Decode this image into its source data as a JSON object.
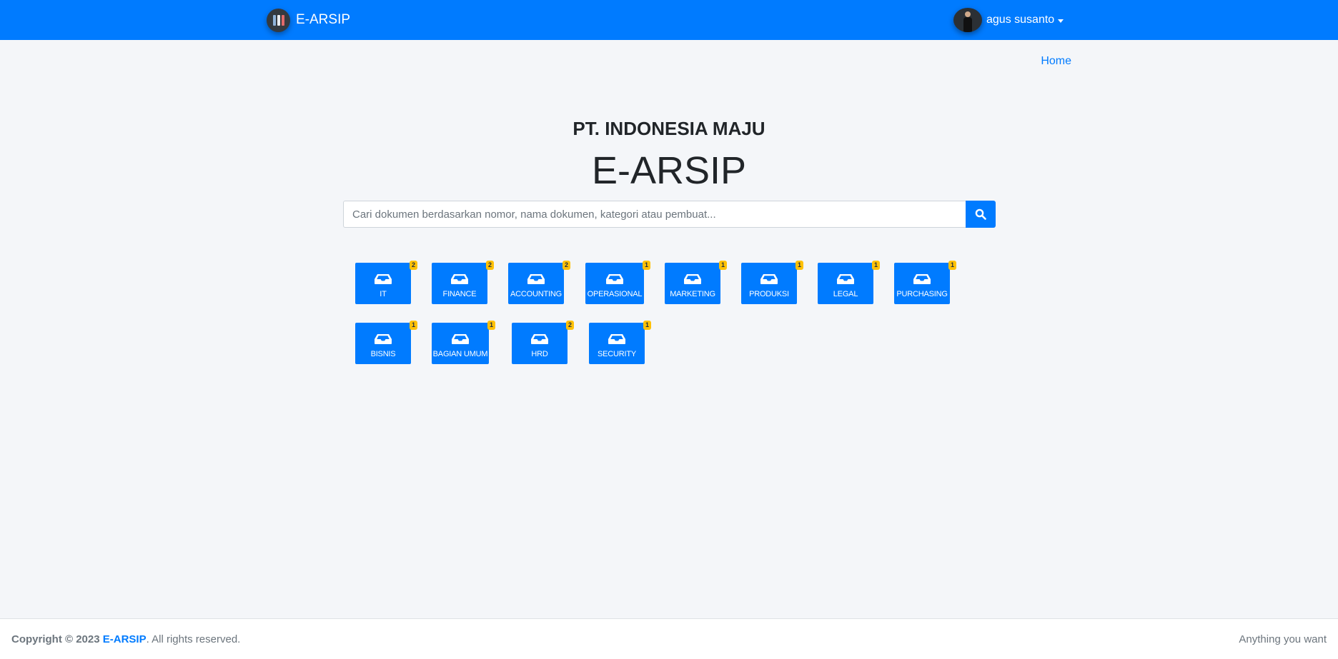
{
  "navbar": {
    "brand": "E-ARSIP",
    "user_name": "agus susanto"
  },
  "breadcrumb": {
    "home": "Home"
  },
  "hero": {
    "company": "PT. INDONESIA MAJU",
    "title": "E-ARSIP"
  },
  "search": {
    "placeholder": "Cari dokumen berdasarkan nomor, nama dokumen, kategori atau pembuat...",
    "value": ""
  },
  "categories": [
    {
      "label": "IT",
      "count": "2"
    },
    {
      "label": "FINANCE",
      "count": "2"
    },
    {
      "label": "ACCOUNTING",
      "count": "2"
    },
    {
      "label": "OPERASIONAL",
      "count": "1"
    },
    {
      "label": "MARKETING",
      "count": "1"
    },
    {
      "label": "PRODUKSI",
      "count": "1"
    },
    {
      "label": "LEGAL",
      "count": "1"
    },
    {
      "label": "PURCHASING",
      "count": "1"
    },
    {
      "label": "BISNIS",
      "count": "1"
    },
    {
      "label": "BAGIAN UMUM",
      "count": "1"
    },
    {
      "label": "HRD",
      "count": "2"
    },
    {
      "label": "SECURITY",
      "count": "1"
    }
  ],
  "footer": {
    "copyright_prefix": "Copyright © 2023",
    "copyright_link": "E-ARSIP",
    "copyright_suffix": ". All rights reserved.",
    "tagline": "Anything you want"
  },
  "colors": {
    "primary": "#007bff",
    "badge": "#ffc107",
    "background": "#f4f6f9"
  }
}
